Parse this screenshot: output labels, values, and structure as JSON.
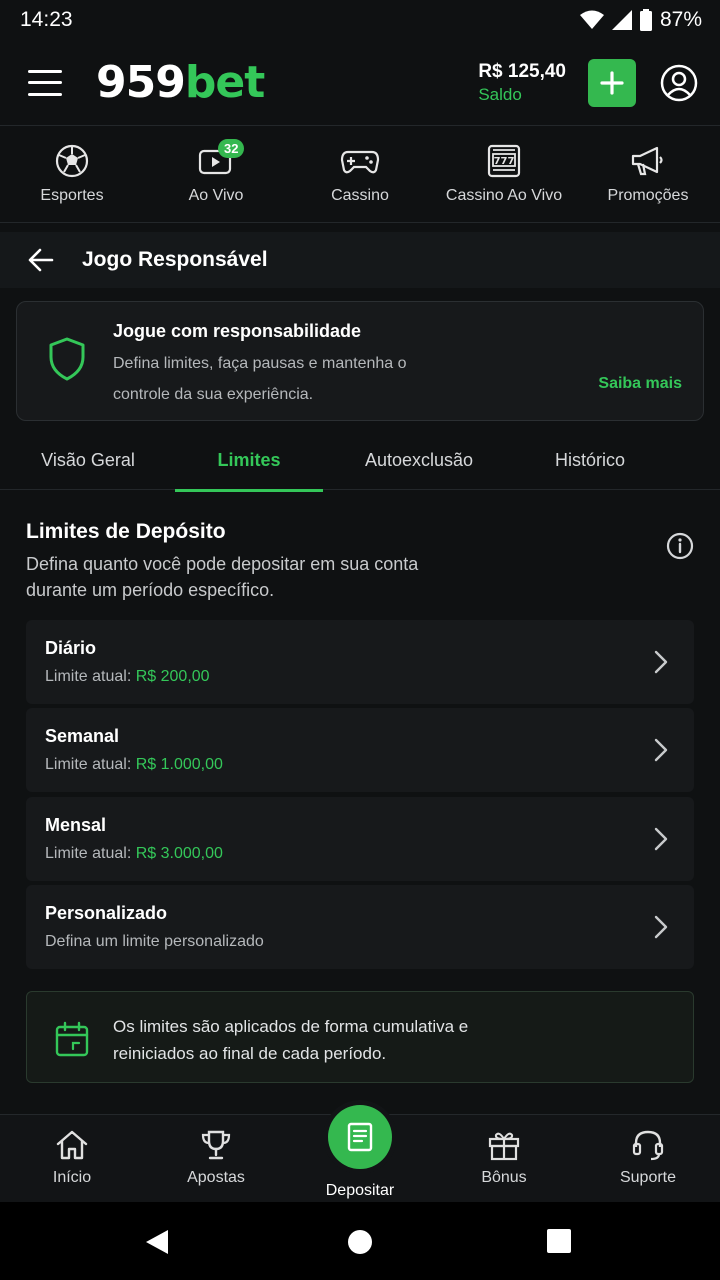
{
  "status_bar": {
    "time": "14:23",
    "battery": "87%"
  },
  "header": {
    "logo_part1": "959",
    "logo_part2": "bet",
    "balance_amount": "R$ 125,40",
    "balance_label": "Saldo",
    "menu_icon": "hamburger-icon",
    "deposit_icon": "plus-icon",
    "profile_icon": "user-icon"
  },
  "top_nav": {
    "items": [
      {
        "label": "Esportes",
        "icon": "soccer-ball-icon"
      },
      {
        "label": "Ao Vivo",
        "icon": "live-video-icon",
        "badge": "32"
      },
      {
        "label": "Cassino",
        "icon": "gamepad-icon"
      },
      {
        "label": "Cassino Ao Vivo",
        "icon": "slot-machine-icon"
      },
      {
        "label": "Promoções",
        "icon": "megaphone-icon"
      }
    ]
  },
  "page": {
    "title": "Jogo Responsável",
    "back_icon": "arrow-left-icon"
  },
  "info_card": {
    "title": "Jogue com responsabilidade",
    "description": "Defina limites, faça pausas e mantenha o controle da sua experiência.",
    "link": "Saiba mais",
    "icon": "shield-icon"
  },
  "tabs": [
    {
      "label": "Visão Geral",
      "active": false
    },
    {
      "label": "Limites",
      "active": true
    },
    {
      "label": "Autoexclusão",
      "active": false
    },
    {
      "label": "Histórico",
      "active": false
    }
  ],
  "section": {
    "title": "Limites de Depósito",
    "description": "Defina quanto você pode depositar em sua conta durante um período específico.",
    "info_icon": "info-icon"
  },
  "limits": [
    {
      "name": "Diário",
      "prefix": "Limite atual: ",
      "value": "R$ 200,00"
    },
    {
      "name": "Semanal",
      "prefix": "Limite atual: ",
      "value": "R$ 1.000,00"
    },
    {
      "name": "Mensal",
      "prefix": "Limite atual: ",
      "value": "R$ 3.000,00"
    },
    {
      "name": "Personalizado",
      "prefix": "Defina um limite personalizado",
      "value": ""
    }
  ],
  "note": {
    "text": "Os limites são aplicados de forma cumulativa e reiniciados ao final de cada período.",
    "icon": "calendar-icon"
  },
  "bottom_nav": {
    "items": [
      {
        "label": "Início",
        "icon": "home-icon"
      },
      {
        "label": "Apostas",
        "icon": "trophy-icon"
      },
      {
        "label": "Depositar",
        "icon": "receipt-icon"
      },
      {
        "label": "Bônus",
        "icon": "gift-icon"
      },
      {
        "label": "Suporte",
        "icon": "headset-icon"
      }
    ]
  },
  "colors": {
    "accent": "#34c759",
    "background": "#0f1112",
    "card": "#17191b"
  }
}
